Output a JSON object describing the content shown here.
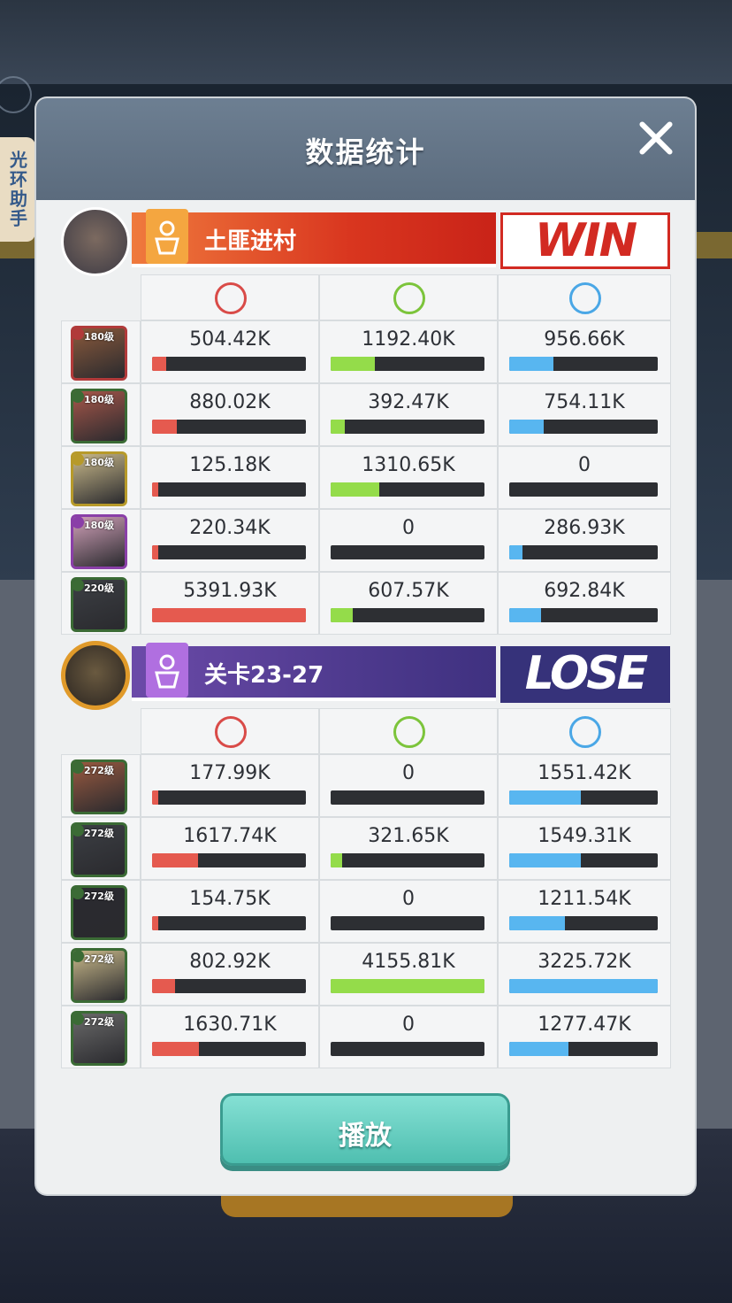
{
  "modal": {
    "title": "数据统计"
  },
  "helper_tab": {
    "label": "光环助手"
  },
  "play_button": {
    "label": "播放"
  },
  "colors": {
    "damage": "#e55a4f",
    "heal": "#94dc4a",
    "defense": "#58b6f0",
    "win": "#d22a22",
    "lose": "#36327a"
  },
  "stat_columns": [
    "damage-icon",
    "heal-icon",
    "shield-icon"
  ],
  "teams": [
    {
      "name": "土匪进村",
      "result": "WIN",
      "heroes": [
        {
          "level": "180级",
          "damage": "504.42K",
          "heal": "1192.40K",
          "defense": "956.66K",
          "damage_frac": 0.094,
          "heal_frac": 0.287,
          "defense_frac": 0.297,
          "border": "#b13a3a",
          "tone": "#8b5a3c"
        },
        {
          "level": "180级",
          "damage": "880.02K",
          "heal": "392.47K",
          "defense": "754.11K",
          "damage_frac": 0.163,
          "heal_frac": 0.094,
          "defense_frac": 0.234,
          "border": "#3b6b35",
          "tone": "#a7574a"
        },
        {
          "level": "180级",
          "damage": "125.18K",
          "heal": "1310.65K",
          "defense": "0",
          "damage_frac": 0.023,
          "heal_frac": 0.315,
          "defense_frac": 0.0,
          "border": "#b79a2a",
          "tone": "#c9b98a"
        },
        {
          "level": "180级",
          "damage": "220.34K",
          "heal": "0",
          "defense": "286.93K",
          "damage_frac": 0.041,
          "heal_frac": 0.0,
          "defense_frac": 0.089,
          "border": "#8a3fa8",
          "tone": "#d0a0b8"
        },
        {
          "level": "220级",
          "damage": "5391.93K",
          "heal": "607.57K",
          "defense": "692.84K",
          "damage_frac": 1.0,
          "heal_frac": 0.146,
          "defense_frac": 0.215,
          "border": "#3b6b35",
          "tone": "#3c3f44"
        }
      ]
    },
    {
      "name": "关卡23-27",
      "result": "LOSE",
      "heroes": [
        {
          "level": "272级",
          "damage": "177.99K",
          "heal": "0",
          "defense": "1551.42K",
          "damage_frac": 0.033,
          "heal_frac": 0.0,
          "defense_frac": 0.481,
          "border": "#3b6b35",
          "tone": "#9a5a40"
        },
        {
          "level": "272级",
          "damage": "1617.74K",
          "heal": "321.65K",
          "defense": "1549.31K",
          "damage_frac": 0.3,
          "heal_frac": 0.077,
          "defense_frac": 0.48,
          "border": "#3b6b35",
          "tone": "#3c3f44"
        },
        {
          "level": "272级",
          "damage": "154.75K",
          "heal": "0",
          "defense": "1211.54K",
          "damage_frac": 0.029,
          "heal_frac": 0.0,
          "defense_frac": 0.376,
          "border": "#3b6b35",
          "tone": "#2a2a30"
        },
        {
          "level": "272级",
          "damage": "802.92K",
          "heal": "4155.81K",
          "defense": "3225.72K",
          "damage_frac": 0.149,
          "heal_frac": 1.0,
          "defense_frac": 1.0,
          "border": "#3b6b35",
          "tone": "#c9b98a"
        },
        {
          "level": "272级",
          "damage": "1630.71K",
          "heal": "0",
          "defense": "1277.47K",
          "damage_frac": 0.302,
          "heal_frac": 0.0,
          "defense_frac": 0.396,
          "border": "#3b6b35",
          "tone": "#6a6a6a"
        }
      ]
    }
  ]
}
